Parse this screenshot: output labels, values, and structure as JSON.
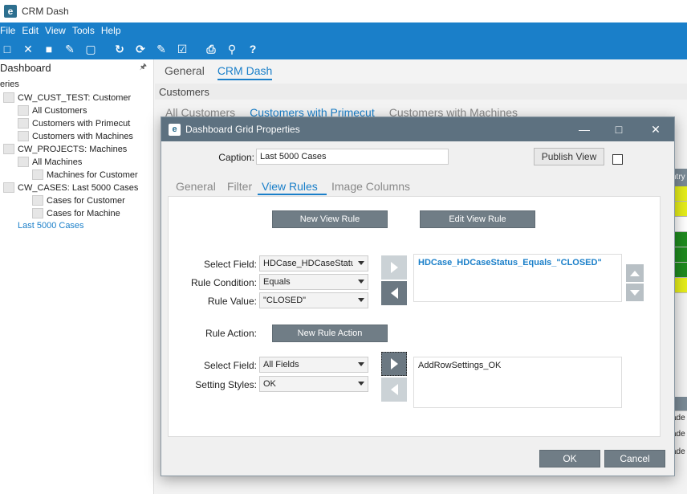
{
  "app": {
    "title": "CRM Dash"
  },
  "menu": [
    "File",
    "Edit",
    "View",
    "Tools",
    "Help"
  ],
  "left_panel": {
    "title": "Dashboard",
    "tree": [
      {
        "label": "eries",
        "indent": 0,
        "icon": false,
        "selected": false
      },
      {
        "label": "CW_CUST_TEST: Customer",
        "indent": 1,
        "icon": true,
        "selected": false
      },
      {
        "label": "All Customers",
        "indent": 2,
        "icon": true,
        "selected": false
      },
      {
        "label": "Customers with Primecut",
        "indent": 2,
        "icon": true,
        "selected": false
      },
      {
        "label": "Customers with Machines",
        "indent": 2,
        "icon": true,
        "selected": false
      },
      {
        "label": "CW_PROJECTS: Machines",
        "indent": 1,
        "icon": true,
        "selected": false
      },
      {
        "label": "All Machines",
        "indent": 2,
        "icon": true,
        "selected": false
      },
      {
        "label": "Machines for Customer",
        "indent": 3,
        "icon": true,
        "selected": false
      },
      {
        "label": "CW_CASES: Last 5000 Cases",
        "indent": 1,
        "icon": true,
        "selected": false
      },
      {
        "label": "Cases for Customer",
        "indent": 3,
        "icon": true,
        "selected": false
      },
      {
        "label": "Cases for Machine",
        "indent": 3,
        "icon": true,
        "selected": false
      },
      {
        "label": "Last 5000 Cases",
        "indent": 2,
        "icon": false,
        "selected": true
      }
    ]
  },
  "main": {
    "tabs": [
      {
        "label": "General",
        "active": false
      },
      {
        "label": "CRM Dash",
        "active": true
      }
    ],
    "breadcrumb": "Customers",
    "subtabs": [
      {
        "label": "All Customers",
        "active": false
      },
      {
        "label": "Customers with Primecut",
        "active": true
      },
      {
        "label": "Customers with Machines",
        "active": false
      }
    ],
    "grid_header_partial": "ntry",
    "grid_row_text": [
      "ade",
      "ade",
      "ade"
    ]
  },
  "dialog": {
    "title": "Dashboard Grid Properties",
    "caption_label": "Caption:",
    "caption_value": "Last 5000 Cases",
    "publish_label": "Publish View",
    "tabs": [
      {
        "label": "General",
        "active": false
      },
      {
        "label": "Filter",
        "active": false
      },
      {
        "label": "View Rules",
        "active": true
      },
      {
        "label": "Image Columns",
        "active": false
      }
    ],
    "new_view_rule": "New View Rule",
    "edit_view_rule": "Edit View Rule",
    "select_field_label": "Select Field:",
    "select_field_value": "HDCase_HDCaseStatus",
    "rule_condition_label": "Rule Condition:",
    "rule_condition_value": "Equals",
    "rule_value_label": "Rule Value:",
    "rule_value_value": "\"CLOSED\"",
    "rules_list": [
      "HDCase_HDCaseStatus_Equals_\"CLOSED\""
    ],
    "rule_action_label": "Rule Action:",
    "new_rule_action": "New Rule Action",
    "select_field2_label": "Select Field:",
    "select_field2_value": "All Fields",
    "setting_styles_label": "Setting Styles:",
    "setting_styles_value": "OK",
    "actions_list": [
      "AddRowSettings_OK"
    ],
    "ok": "OK",
    "cancel": "Cancel"
  },
  "colors": {
    "accent": "#1a7fc9",
    "dialog_title": "#5d7180",
    "button_dark": "#707d86",
    "grid_yellow": "#e6ee1a",
    "grid_green": "#1f8a1f"
  }
}
